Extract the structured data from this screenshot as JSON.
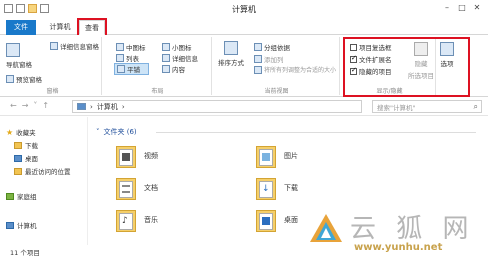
{
  "window": {
    "title": "计算机"
  },
  "tabs": {
    "file": "文件",
    "computer": "计算机",
    "view": "查看"
  },
  "ribbon": {
    "panes": {
      "nav_pane": "导航窗格",
      "preview_pane": "预览窗格",
      "details_pane": "详细信息窗格",
      "label": "窗格"
    },
    "layout": {
      "medium_icons": "中图标",
      "small_icons": "小图标",
      "list": "列表",
      "details": "详细信息",
      "tiles": "平铺",
      "content": "内容",
      "label": "布局"
    },
    "current_view": {
      "sort_by": "排序方式",
      "group_by": "分组依据",
      "add_columns": "添加列",
      "size_all_columns": "将所有列调整为合适的大小",
      "label": "当前视图"
    },
    "show_hide": {
      "item_checkboxes": "项目复选框",
      "file_name_extensions": "文件扩展名",
      "hidden_items": "隐藏的项目",
      "hide_selected_items_1": "隐藏",
      "hide_selected_items_2": "所选项目",
      "label": "显示/隐藏",
      "item_checkboxes_checked": false,
      "file_name_extensions_checked": true,
      "hidden_items_checked": true
    },
    "options": "选项"
  },
  "address": {
    "path": "计算机",
    "search_placeholder": "搜索\"计算机\""
  },
  "nav": {
    "favorites": "收藏夹",
    "downloads": "下载",
    "desktop": "桌面",
    "recent": "最近访问的位置",
    "homegroup": "家庭组",
    "computer": "计算机"
  },
  "content": {
    "section_title": "文件夹 (6)",
    "folders": [
      "视频",
      "图片",
      "文档",
      "下载",
      "音乐",
      "桌面"
    ]
  },
  "status": {
    "count": "11 个项目"
  },
  "watermark": {
    "text": "云 狐 网",
    "url": "www.yunhu.net"
  },
  "colors": {
    "accent": "#1979ca",
    "highlight_border": "#dd1122",
    "folder": "#f5cf6a"
  }
}
